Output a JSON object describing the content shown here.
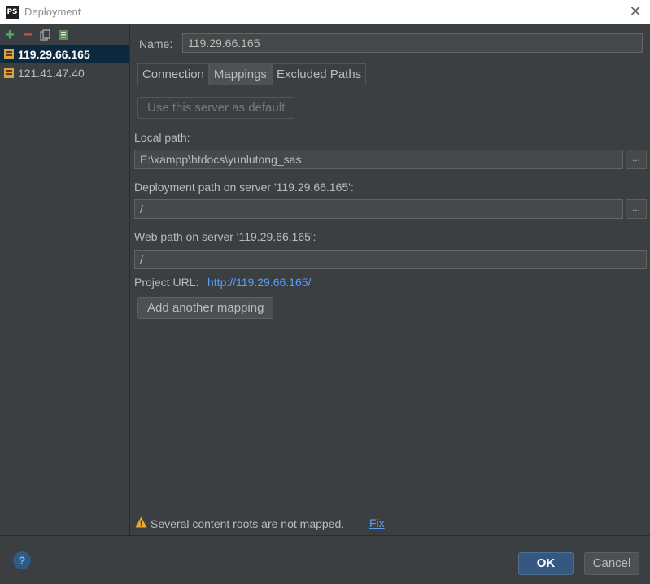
{
  "window": {
    "title": "Deployment",
    "app_icon": "PS"
  },
  "sidebar": {
    "servers": [
      {
        "name": "119.29.66.165",
        "selected": true
      },
      {
        "name": "121.41.47.40",
        "selected": false
      }
    ]
  },
  "form": {
    "name_label": "Name:",
    "name_value": "119.29.66.165",
    "tabs": [
      "Connection",
      "Mappings",
      "Excluded Paths"
    ],
    "active_tab": "Mappings",
    "default_button": "Use this server as default",
    "local_path_label": "Local path:",
    "local_path_value": "E:\\xampp\\htdocs\\yunlutong_sas",
    "deploy_path_label": "Deployment path on server '119.29.66.165':",
    "deploy_path_value": "/",
    "web_path_label": "Web path on server '119.29.66.165':",
    "web_path_value": "/",
    "project_url_label": "Project URL:",
    "project_url_value": "http://119.29.66.165/",
    "add_mapping_button": "Add another mapping",
    "browse_label": "..."
  },
  "warning": {
    "text": "Several content roots are not mapped.",
    "fix_label": "Fix"
  },
  "footer": {
    "help_label": "?",
    "ok_label": "OK",
    "cancel_label": "Cancel"
  },
  "colors": {
    "background": "#3c3f41",
    "selected": "#0d293e",
    "link": "#589df6",
    "ok": "#365880"
  }
}
